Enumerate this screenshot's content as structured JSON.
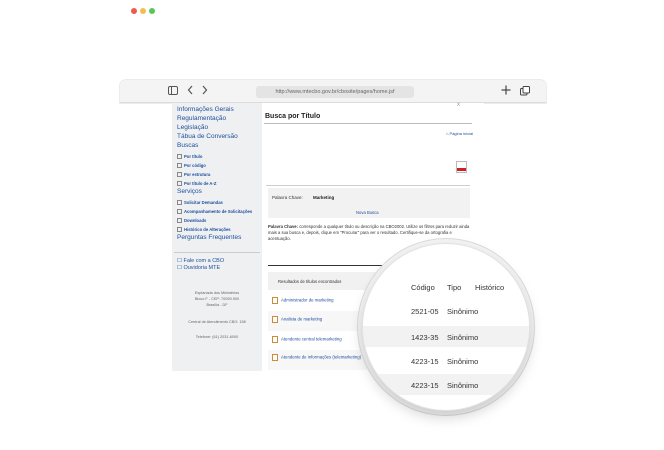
{
  "browser": {
    "url": "http://www.mtecbo.gov.br/cbosite/pages/home.jsf",
    "colors": {
      "close": "#ee5a52",
      "minimize": "#f5bd4f",
      "maximize": "#5bc653"
    },
    "icons": [
      "sidebar-icon",
      "back-icon",
      "forward-icon",
      "new-tab-icon",
      "tabs-icon"
    ]
  },
  "sidebar": {
    "menu": [
      "Informações Gerais",
      "Regulamentação",
      "Legislação",
      "Tábua de Conversão",
      "Buscas"
    ],
    "buscas_sub": [
      "Por título",
      "Por código",
      "Por estrutura",
      "Por título de A-Z"
    ],
    "servicos": "Serviços",
    "servicos_sub": [
      "Solicitar Demandas",
      "Acompanhamento de Solicitações",
      "Downloads",
      "Histórico de Alterações"
    ],
    "perguntas": "Perguntas Frequentes",
    "links": [
      "Fale com a CBO",
      "Ouvidoria MTE"
    ],
    "address": [
      "Esplanada dos Ministérios",
      "Bloco F - CEP: 70059-900",
      "Brasília - DF"
    ],
    "central": "Central de Atendimento CBO: 158",
    "telefone": "Telefone: (61) 2031-6000"
  },
  "content": {
    "title": "Busca por Título",
    "close": "x",
    "pagina_inicial": "Página inicial",
    "palavra_label": "Palavra Chave:",
    "palavra_value": "Marketing",
    "nova_busca": "Nova Busca",
    "hint_bold": "Palavra Chave:",
    "hint_text": "corresponde a qualquer título ou descrição na CBO2002. Utilize os filtros para reduzir ainda mais a sua busca e, depois, clique em \"Procurar\" para ver o resultado. Certifique-se da ortografia e acentuação.",
    "results_header": "Resultados de títulos encontrados",
    "results": [
      "Administrador de marketing",
      "Analista de marketing",
      "Atendente central telemarketing",
      "Atendente de informações (telemarketing)"
    ]
  },
  "magnifier": {
    "headers": [
      "Código",
      "Tipo",
      "Histórico"
    ],
    "rows": [
      {
        "codigo": "2521-05",
        "tipo": "Sinônimo"
      },
      {
        "codigo": "1423-35",
        "tipo": "Sinônimo"
      },
      {
        "codigo": "4223-15",
        "tipo": "Sinônimo"
      },
      {
        "codigo": "4223-15",
        "tipo": "Sinônimo"
      }
    ]
  }
}
